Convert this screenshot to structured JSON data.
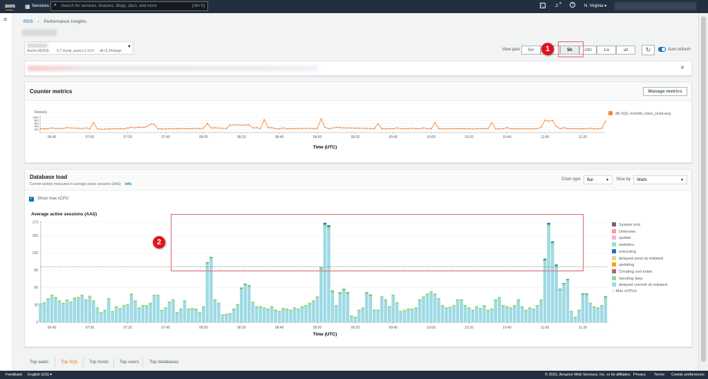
{
  "nav": {
    "logo": "aws",
    "services": "Services",
    "search_placeholder": "Search for services, features, blogs, docs, and more",
    "search_shortcut": "[Alt+S]",
    "region": "N. Virginia"
  },
  "breadcrumb": {
    "root": "RDS",
    "current": "Performance Insights"
  },
  "instance": {
    "engine": "Aurora MySQL",
    "version": "5.7.mysql_aurora.2.10.0",
    "class": "db.r5.24xlarge"
  },
  "view_past": {
    "label": "View past",
    "options": [
      "5m",
      "",
      "5h",
      "24h",
      "1w",
      "all"
    ],
    "selected": "5h",
    "auto_refresh_label": "Auto refresh",
    "auto_refresh": true
  },
  "annotations": [
    "1",
    "2"
  ],
  "counter": {
    "title": "Counter metrics",
    "manage_button": "Manage metrics"
  },
  "dbload": {
    "title": "Database load",
    "subtitle": "Current activity measured in average active sessions (AAS)",
    "info": "Info",
    "chart_type_label": "Chart type",
    "chart_type": "Bar",
    "slice_by_label": "Slice by",
    "slice_by": "Waits",
    "show_max_vcpu_label": "Show max vCPU",
    "show_max_vcpu": true
  },
  "tabs": [
    "Top waits",
    "Top SQL",
    "Top hosts",
    "Top users",
    "Top databases"
  ],
  "active_tab": "Top SQL",
  "footer": {
    "feedback": "Feedback",
    "language": "English (US)",
    "copyright": "© 2022, Amazon Web Services, Inc. or its affiliates.",
    "privacy": "Privacy",
    "terms": "Terms",
    "cookies": "Cookie preferences"
  },
  "colors": {
    "nav": "#232f3e",
    "accent": "#0073bb",
    "orange": "#ec7211",
    "annotation": "#e0141e"
  },
  "chart_data": [
    {
      "type": "line",
      "ylabel": "Rows/s",
      "xlabel": "Time (UTC)",
      "ylim": [
        0,
        10
      ],
      "yunit": "m",
      "yticks": [
        "2m",
        "4m",
        "6m",
        "8m",
        "10m"
      ],
      "xticks": [
        "06:40",
        "07:00",
        "07:20",
        "07:40",
        "08:00",
        "08:20",
        "08:40",
        "09:00",
        "09:20",
        "09:40",
        "10:00",
        "10:20",
        "10:40",
        "11:00",
        "11:20"
      ],
      "x_start": "06:34",
      "x_step_minutes": 2,
      "series": [
        {
          "name": "db.SQL.innodb_rows_read.avg",
          "color": "#f58536",
          "values": [
            2.5,
            2.5,
            2.5,
            3,
            2.6,
            2.7,
            2.7,
            3.2,
            3,
            2.9,
            2.8,
            2.6,
            3,
            2.4,
            6.5,
            2.4,
            2.2,
            2.3,
            2.5,
            2.4,
            2.5,
            2.6,
            2.4,
            3,
            3.4,
            3.1,
            3.6,
            3.2,
            3.9,
            5.5,
            5.4,
            2.4,
            2.5,
            2.3,
            2.6,
            2.4,
            2.5,
            2.7,
            2.6,
            2.5,
            2.6,
            2.7,
            2.6,
            2.9,
            6,
            3,
            3.1,
            3,
            2.8,
            2.7,
            5,
            5.1,
            5,
            4.9,
            5,
            5.1,
            3,
            3.2,
            2.6,
            8.5,
            3.2,
            3.2,
            2.6,
            2.5,
            3,
            2.5,
            2.6,
            2.6,
            2.7,
            2.7,
            2.8,
            2.7,
            2.6,
            2.7,
            9,
            3.5,
            2.5,
            3,
            3.4,
            3.2,
            3.1,
            3,
            3,
            2.9,
            2.9,
            2.8,
            2.7,
            2.6,
            2.5,
            5.8,
            2.5,
            2.4,
            2.6,
            2.5,
            3,
            2.6,
            2.5,
            2.6,
            2.8,
            2.5,
            2.6,
            3,
            2.6,
            2.5,
            6.5,
            2.6,
            2.5,
            2.4,
            2.6,
            2.5,
            2.6,
            2.5,
            2.5,
            2.6,
            2.4,
            2.5,
            2.6,
            2.6,
            2.5,
            6.5,
            2.5,
            2.4,
            2.5,
            3.2,
            2.5,
            2.4,
            2.5,
            2.4,
            2.6,
            2.5,
            2.5,
            2.6,
            3.4,
            8.2,
            7.4,
            8,
            4,
            2.6,
            3.1,
            2.6,
            2.5,
            2.6,
            2.5,
            2.5,
            2.6,
            2.8,
            2.5,
            2.4,
            2.8,
            7.5
          ]
        }
      ]
    },
    {
      "type": "bar",
      "stacked": true,
      "title": "Average active sessions (AAS)",
      "xlabel": "Time (UTC)",
      "ylim": [
        0,
        173
      ],
      "yticks": [
        0,
        30,
        60,
        90,
        120,
        150,
        173
      ],
      "xticks": [
        "06:40",
        "07:00",
        "07:20",
        "07:40",
        "08:00",
        "08:20",
        "08:40",
        "09:00",
        "09:20",
        "09:40",
        "10:00",
        "10:20",
        "10:40",
        "11:00",
        "11:20"
      ],
      "x_start": "06:34",
      "x_step_minutes": 2,
      "max_vcpu": 96,
      "max_vcpu_label": "Max vCPUs",
      "legend": [
        {
          "name": "System lock",
          "color": "#7d5a96"
        },
        {
          "name": "Unknown",
          "color": "#ff9896"
        },
        {
          "name": "update",
          "color": "#f7b6d2"
        },
        {
          "name": "statistics",
          "color": "#98dfc4"
        },
        {
          "name": "executing",
          "color": "#1f77b4"
        },
        {
          "name": "delayed send ok initiated",
          "color": "#dbdb8d"
        },
        {
          "name": "updating",
          "color": "#ffa500"
        },
        {
          "name": "Creating sort index",
          "color": "#ad6a6c"
        },
        {
          "name": "Sending data",
          "color": "#98d68a"
        },
        {
          "name": "delayed commit ok initiated",
          "color": "#9edae5"
        }
      ],
      "series": [
        {
          "name": "delayed commit ok initiated",
          "values": [
            30,
            32,
            39,
            45,
            41,
            35,
            31,
            37,
            33,
            40,
            41,
            45,
            37,
            43,
            35,
            23,
            15,
            19,
            39,
            17,
            25,
            22,
            27,
            29,
            47,
            35,
            23,
            27,
            27,
            31,
            45,
            45,
            19,
            23,
            33,
            37,
            15,
            21,
            35,
            21,
            22,
            21,
            15,
            25,
            100,
            109,
            37,
            31,
            11,
            12,
            13,
            21,
            29,
            56,
            63,
            60,
            33,
            25,
            25,
            23,
            21,
            25,
            19,
            17,
            22,
            21,
            19,
            23,
            21,
            25,
            27,
            31,
            35,
            42,
            90,
            165,
            161,
            51,
            27,
            48,
            54,
            48,
            9,
            7,
            19,
            23,
            48,
            44,
            19,
            19,
            42,
            37,
            25,
            45,
            32,
            17,
            19,
            21,
            21,
            23,
            37,
            42,
            47,
            51,
            47,
            39,
            27,
            23,
            24,
            27,
            37,
            37,
            27,
            23,
            19,
            25,
            22,
            27,
            19,
            21,
            37,
            41,
            27,
            25,
            23,
            27,
            37,
            25,
            19,
            23,
            21,
            27,
            37,
            104,
            165,
            134,
            95,
            54,
            64,
            71,
            17,
            7,
            19,
            46,
            46,
            31,
            25,
            23,
            27,
            41
          ]
        },
        {
          "name": "Sending data",
          "values": [
            3,
            3,
            3,
            3,
            3,
            3,
            3,
            3,
            3,
            3,
            3,
            3,
            3,
            3,
            3,
            3,
            3,
            3,
            3,
            3,
            3,
            3,
            3,
            3,
            3,
            3,
            3,
            3,
            3,
            3,
            3,
            3,
            3,
            3,
            3,
            3,
            3,
            3,
            3,
            3,
            3,
            3,
            3,
            3,
            3,
            3,
            3,
            3,
            3,
            3,
            3,
            3,
            3,
            3,
            3,
            3,
            3,
            3,
            3,
            3,
            3,
            3,
            3,
            3,
            3,
            3,
            3,
            3,
            3,
            3,
            3,
            3,
            3,
            3,
            4,
            4,
            4,
            3,
            3,
            3,
            3,
            3,
            3,
            3,
            3,
            3,
            3,
            3,
            3,
            3,
            3,
            3,
            3,
            3,
            3,
            3,
            3,
            3,
            3,
            3,
            3,
            3,
            3,
            3,
            3,
            3,
            3,
            3,
            3,
            3,
            3,
            3,
            3,
            3,
            3,
            3,
            3,
            3,
            3,
            3,
            3,
            3,
            3,
            3,
            3,
            3,
            3,
            3,
            3,
            3,
            3,
            3,
            3,
            4,
            4,
            4,
            3,
            3,
            3,
            3,
            3,
            3,
            3,
            3,
            3,
            3,
            3,
            3,
            3,
            3
          ]
        },
        {
          "name": "executing",
          "values": [
            0,
            0,
            0,
            0,
            0,
            0,
            0,
            0,
            0,
            0,
            0,
            0,
            0,
            0,
            0,
            0,
            0,
            0,
            0,
            0,
            0,
            0,
            0,
            0,
            0,
            0,
            0,
            0,
            0,
            0,
            0,
            0,
            0,
            0,
            0,
            0,
            0,
            0,
            0,
            0,
            0,
            0,
            0,
            0,
            1,
            1,
            0,
            0,
            0,
            0,
            0,
            0,
            0,
            1,
            1,
            1,
            0,
            0,
            0,
            0,
            0,
            0,
            0,
            0,
            0,
            0,
            0,
            0,
            0,
            0,
            0,
            0,
            0,
            0,
            1,
            3,
            3,
            1,
            0,
            1,
            1,
            1,
            0,
            0,
            0,
            0,
            1,
            1,
            0,
            0,
            0,
            0,
            0,
            0,
            0,
            0,
            0,
            0,
            0,
            0,
            0,
            0,
            0,
            0,
            0,
            0,
            0,
            0,
            0,
            0,
            0,
            0,
            0,
            0,
            0,
            0,
            0,
            0,
            0,
            0,
            0,
            0,
            0,
            0,
            0,
            0,
            0,
            0,
            0,
            0,
            0,
            0,
            0,
            2,
            3,
            2,
            2,
            1,
            1,
            1,
            0,
            0,
            0,
            1,
            1,
            0,
            0,
            0,
            0,
            1
          ]
        }
      ]
    }
  ]
}
